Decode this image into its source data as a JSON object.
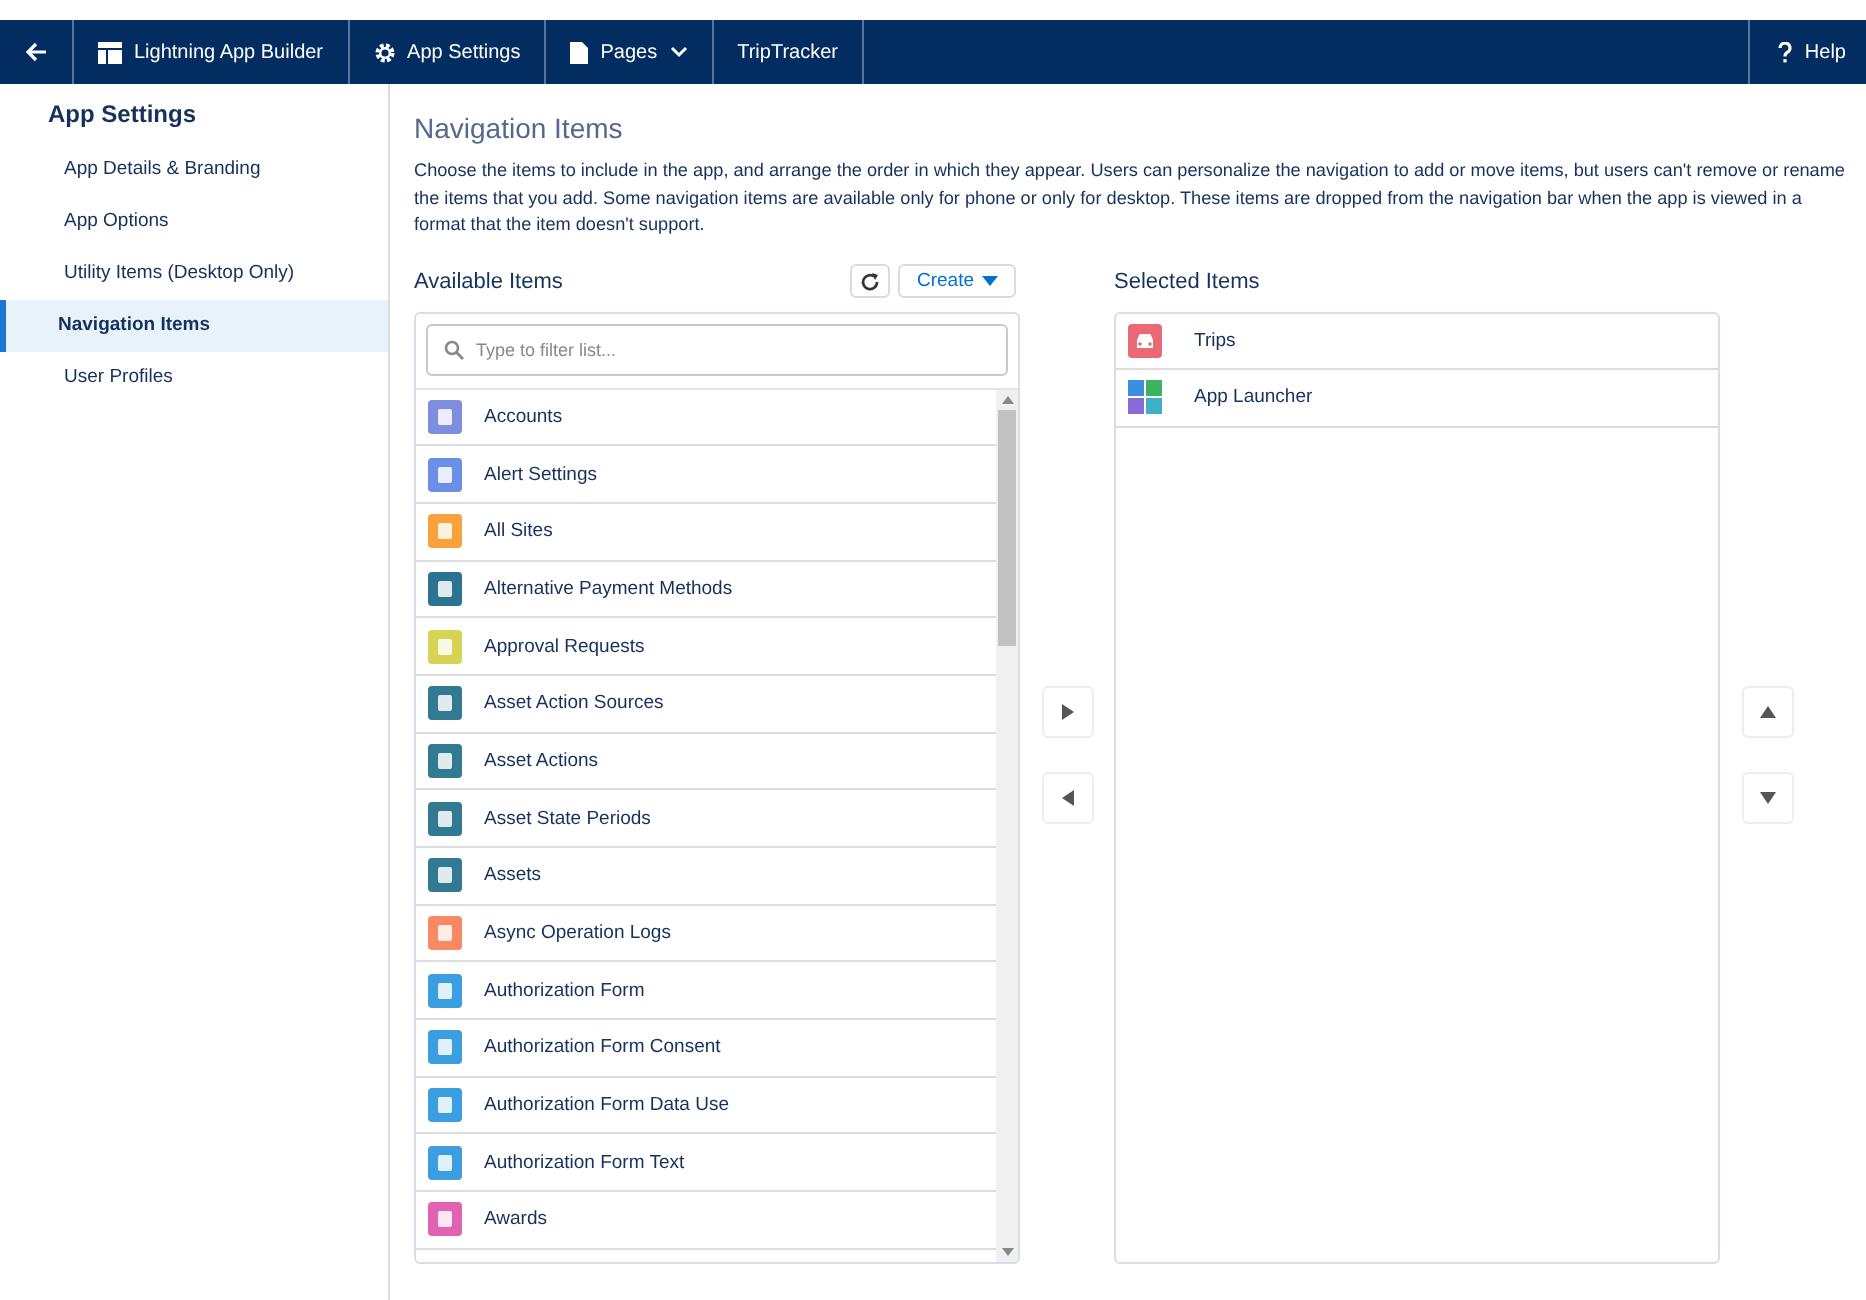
{
  "top_nav": {
    "items": [
      {
        "label": "Lightning App Builder",
        "kind": "builder"
      },
      {
        "label": "App Settings",
        "kind": "gear"
      },
      {
        "label": "Pages",
        "kind": "page"
      },
      {
        "label": "TripTracker",
        "kind": "plain"
      }
    ],
    "help": "Help"
  },
  "sidebar": {
    "title": "App Settings",
    "items": [
      {
        "label": "App Details & Branding",
        "selected": false
      },
      {
        "label": "App Options",
        "selected": false
      },
      {
        "label": "Utility Items (Desktop Only)",
        "selected": false
      },
      {
        "label": "Navigation Items",
        "selected": true
      },
      {
        "label": "User Profiles",
        "selected": false
      }
    ]
  },
  "main": {
    "title": "Navigation Items",
    "description": "Choose the items to include in the app, and arrange the order in which they appear. Users can personalize the navigation to add or move items, but users can't remove or rename the items that you add. Some navigation items are available only for phone or only for desktop. These items are dropped from the navigation bar when the app is viewed in a format that the item doesn't support.",
    "available": {
      "heading": "Available Items",
      "create": "Create",
      "search": {
        "placeholder": "Type to filter list..."
      },
      "items": [
        {
          "label": "Accounts",
          "color": "#7f8de1"
        },
        {
          "label": "Alert Settings",
          "color": "#6b8ee6"
        },
        {
          "label": "All Sites",
          "color": "#f9a13d"
        },
        {
          "label": "Alternative Payment Methods",
          "color": "#2a7391"
        },
        {
          "label": "Approval Requests",
          "color": "#d7d354"
        },
        {
          "label": "Asset Action Sources",
          "color": "#317a92"
        },
        {
          "label": "Asset Actions",
          "color": "#317a92"
        },
        {
          "label": "Asset State Periods",
          "color": "#317a92"
        },
        {
          "label": "Assets",
          "color": "#317a92"
        },
        {
          "label": "Async Operation Logs",
          "color": "#f88962"
        },
        {
          "label": "Authorization Form",
          "color": "#3b9ee0"
        },
        {
          "label": "Authorization Form Consent",
          "color": "#3b9ee0"
        },
        {
          "label": "Authorization Form Data Use",
          "color": "#3b9ee0"
        },
        {
          "label": "Authorization Form Text",
          "color": "#3b9ee0"
        },
        {
          "label": "Awards",
          "color": "#e262b2"
        }
      ]
    },
    "selected": {
      "heading": "Selected Items",
      "items": [
        {
          "label": "Trips",
          "kind": "car"
        },
        {
          "label": "App Launcher",
          "kind": "launcher"
        }
      ]
    }
  }
}
